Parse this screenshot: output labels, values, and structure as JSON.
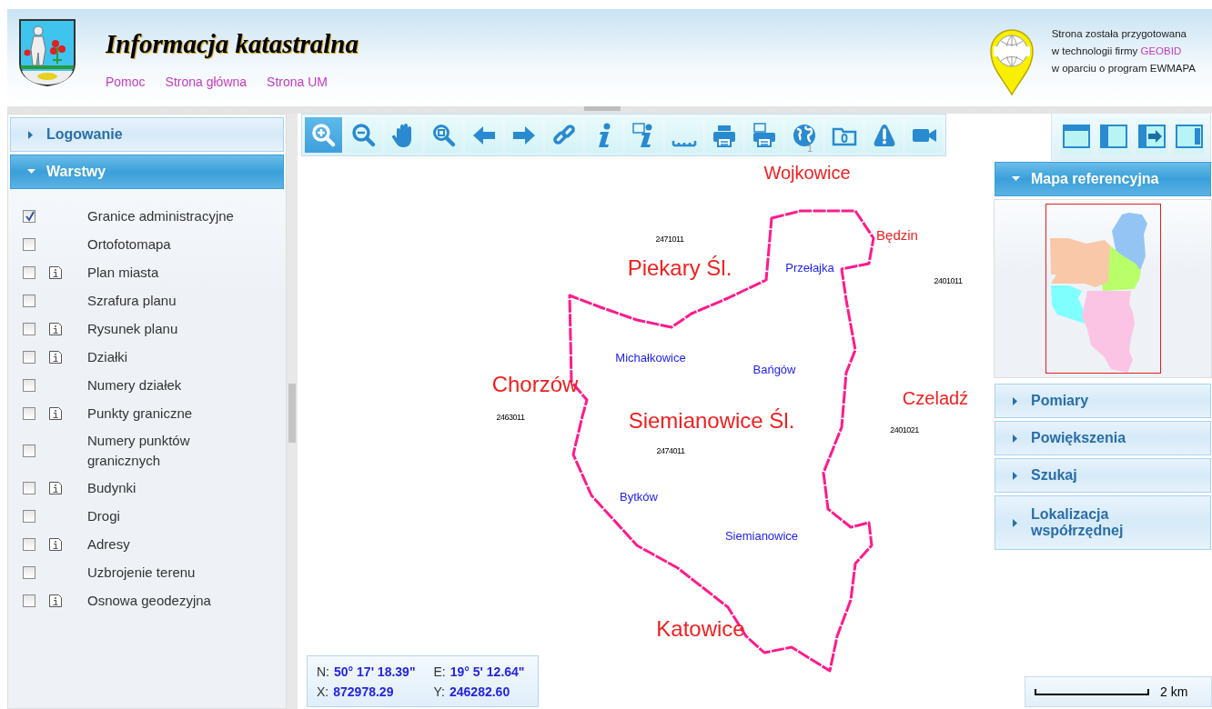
{
  "header": {
    "title": "Informacja katastralna",
    "links": [
      "Pomoc",
      "Strona główna",
      "Strona UM"
    ],
    "credit": {
      "line1": "Strona została przygotowana",
      "line2": "w technologii firmy",
      "brand": "GEOBID",
      "line3": "w oparciu o program EWMAPA"
    }
  },
  "left_panel": {
    "sections": [
      {
        "title": "Logowanie",
        "expanded": false
      },
      {
        "title": "Warstwy",
        "expanded": true
      }
    ],
    "layers": [
      {
        "label": "Granice administracyjne",
        "checked": true,
        "info": false
      },
      {
        "label": "Ortofotomapa",
        "checked": false,
        "info": false
      },
      {
        "label": "Plan miasta",
        "checked": false,
        "info": true
      },
      {
        "label": "Szrafura planu",
        "checked": false,
        "info": false
      },
      {
        "label": "Rysunek planu",
        "checked": false,
        "info": true
      },
      {
        "label": "Działki",
        "checked": false,
        "info": true
      },
      {
        "label": "Numery działek",
        "checked": false,
        "info": false
      },
      {
        "label": "Punkty graniczne",
        "checked": false,
        "info": true
      },
      {
        "label": "Numery punktów granicznych",
        "checked": false,
        "info": false
      },
      {
        "label": "Budynki",
        "checked": false,
        "info": true
      },
      {
        "label": "Drogi",
        "checked": false,
        "info": false
      },
      {
        "label": "Adresy",
        "checked": false,
        "info": true
      },
      {
        "label": "Uzbrojenie terenu",
        "checked": false,
        "info": false
      },
      {
        "label": "Osnowa geodezyjna",
        "checked": false,
        "info": true
      }
    ]
  },
  "toolbar": {
    "buttons": [
      {
        "selected": true
      },
      {
        "selected": false
      },
      {
        "selected": false
      },
      {
        "selected": false
      },
      {
        "selected": false
      },
      {
        "selected": false
      },
      {
        "selected": false
      },
      {
        "selected": false
      },
      {
        "selected": false
      },
      {
        "selected": false
      },
      {
        "selected": false
      },
      {
        "selected": false
      },
      {
        "selected": false
      },
      {
        "selected": false
      },
      {
        "selected": false
      },
      {
        "selected": false
      }
    ]
  },
  "map": {
    "labels": [
      {
        "text": "1",
        "kind": "note"
      },
      {
        "text": "Wojkowice",
        "kind": "city"
      },
      {
        "text": "Będzin",
        "kind": "town"
      },
      {
        "text": "2471011",
        "kind": "sheet"
      },
      {
        "text": "Piekary Śl.",
        "kind": "major"
      },
      {
        "text": "Przełajka",
        "kind": "district"
      },
      {
        "text": "2401011",
        "kind": "sheet"
      },
      {
        "text": "Michałkowice",
        "kind": "district"
      },
      {
        "text": "Bańgów",
        "kind": "district"
      },
      {
        "text": "Chorzów",
        "kind": "major"
      },
      {
        "text": "Czeladź",
        "kind": "city"
      },
      {
        "text": "2463011",
        "kind": "sheet"
      },
      {
        "text": "Siemianowice Śl.",
        "kind": "major"
      },
      {
        "text": "2401021",
        "kind": "sheet"
      },
      {
        "text": "2474011",
        "kind": "sheet"
      },
      {
        "text": "Bytków",
        "kind": "district"
      },
      {
        "text": "Siemianowice",
        "kind": "district"
      },
      {
        "text": "Katowice",
        "kind": "major"
      }
    ],
    "coordinates": [
      {
        "label": "N:",
        "value": "50° 17' 18.39\""
      },
      {
        "label": "E:",
        "value": "19° 5' 12.64\""
      },
      {
        "label": "X:",
        "value": "872978.29"
      },
      {
        "label": "Y:",
        "value": "246282.60"
      }
    ]
  },
  "right_panel": {
    "view_buttons": [
      {
        "selected": false
      },
      {
        "selected": false
      },
      {
        "selected": false
      },
      {
        "selected": false
      }
    ],
    "sections": [
      {
        "title": "Mapa referencyjna",
        "expanded": true
      },
      {
        "title": "Pomiary",
        "expanded": false
      },
      {
        "title": "Powiększenia",
        "expanded": false
      },
      {
        "title": "Szukaj",
        "expanded": false
      },
      {
        "title": "Lokalizacja współrzędnej",
        "expanded": false
      }
    ],
    "scale": "2 km"
  }
}
